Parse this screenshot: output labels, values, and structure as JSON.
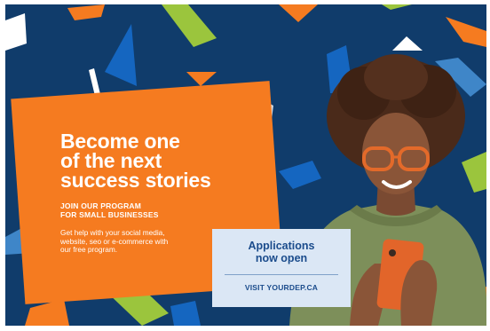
{
  "card": {
    "headline_line1": "Become one",
    "headline_line2": "of the next",
    "headline_line3": "success stories",
    "subhead_line1": "JOIN OUR PROGRAM",
    "subhead_line2": "FOR SMALL BUSINESSES",
    "body_line1": "Get help with your social media,",
    "body_line2": "website, seo or e-commerce with",
    "body_line3": "our free program."
  },
  "cta": {
    "applications_line1": "Applications",
    "applications_line2": "now open",
    "visit": "VISIT YOURDEP.CA"
  },
  "colors": {
    "background": "#103c6b",
    "orange": "#f57b20",
    "lime": "#9bc53d",
    "blue": "#1566c0",
    "light_box": "#dbe7f5",
    "text_blue": "#1b4c8c"
  }
}
